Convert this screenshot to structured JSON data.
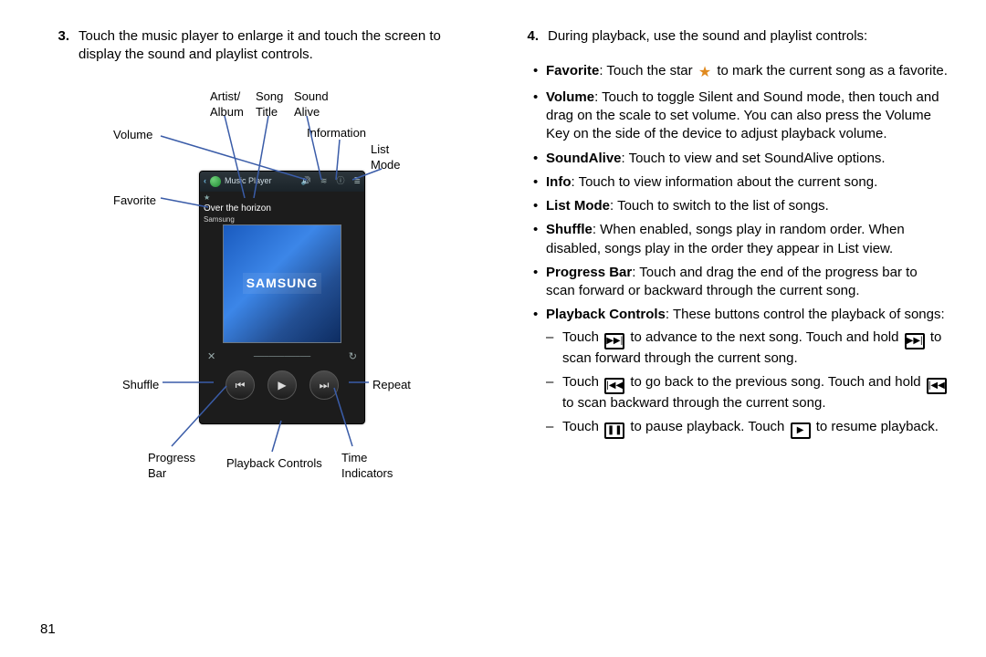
{
  "page_number": "81",
  "step3": {
    "number": "3.",
    "text": "Touch the music player to enlarge it and touch the screen to display the sound and playlist controls."
  },
  "step4": {
    "number": "4.",
    "text": "During playback, use the sound and playlist controls:"
  },
  "diagram_labels": {
    "volume": "Volume",
    "artist_album": "Artist/\nAlbum",
    "song_title": "Song\nTitle",
    "sound_alive": "Sound\nAlive",
    "information": "Information",
    "list_mode": "List\nMode",
    "favorite": "Favorite",
    "shuffle": "Shuffle",
    "repeat": "Repeat",
    "progress_bar": "Progress\nBar",
    "playback_controls": "Playback Controls",
    "time_indicators": "Time\nIndicators"
  },
  "phone": {
    "header": "Music Player",
    "song_title": "Over the horizon",
    "song_artist": "Samsung",
    "artwork_text": "SAMSUNG"
  },
  "bullets": {
    "favorite": {
      "term": "Favorite",
      "before": ": Touch the star ",
      "after": " to mark the current song as a favorite."
    },
    "volume": {
      "term": "Volume",
      "text": ": Touch to toggle Silent and Sound mode, then touch and drag on the scale to set volume. You can also press the Volume Key on the side of the device to adjust playback volume."
    },
    "soundalive": {
      "term": "SoundAlive",
      "text": ": Touch to view and set SoundAlive options."
    },
    "info": {
      "term": "Info",
      "text": ": Touch to view information about the current song."
    },
    "listmode": {
      "term": "List Mode",
      "text": ": Touch to switch to the list of songs."
    },
    "shuffle": {
      "term": "Shuffle",
      "text": ": When enabled, songs play in random order. When disabled, songs play in the order they appear in List view."
    },
    "progress": {
      "term": "Progress Bar",
      "text": ": Touch and drag the end of the progress bar to scan forward or backward through the current song."
    },
    "playback": {
      "term": "Playback Controls",
      "text": ": These buttons control the playback of songs:"
    }
  },
  "dashes": {
    "next": {
      "a": "Touch ",
      "b": " to advance to the next song. Touch and hold ",
      "c": " to scan forward through the current song."
    },
    "prev": {
      "a": "Touch ",
      "b": " to go back to the previous song. Touch and hold ",
      "c": " to scan backward through the current song."
    },
    "pause": {
      "a": "Touch ",
      "b": " to pause playback. Touch ",
      "c": " to resume playback."
    }
  }
}
